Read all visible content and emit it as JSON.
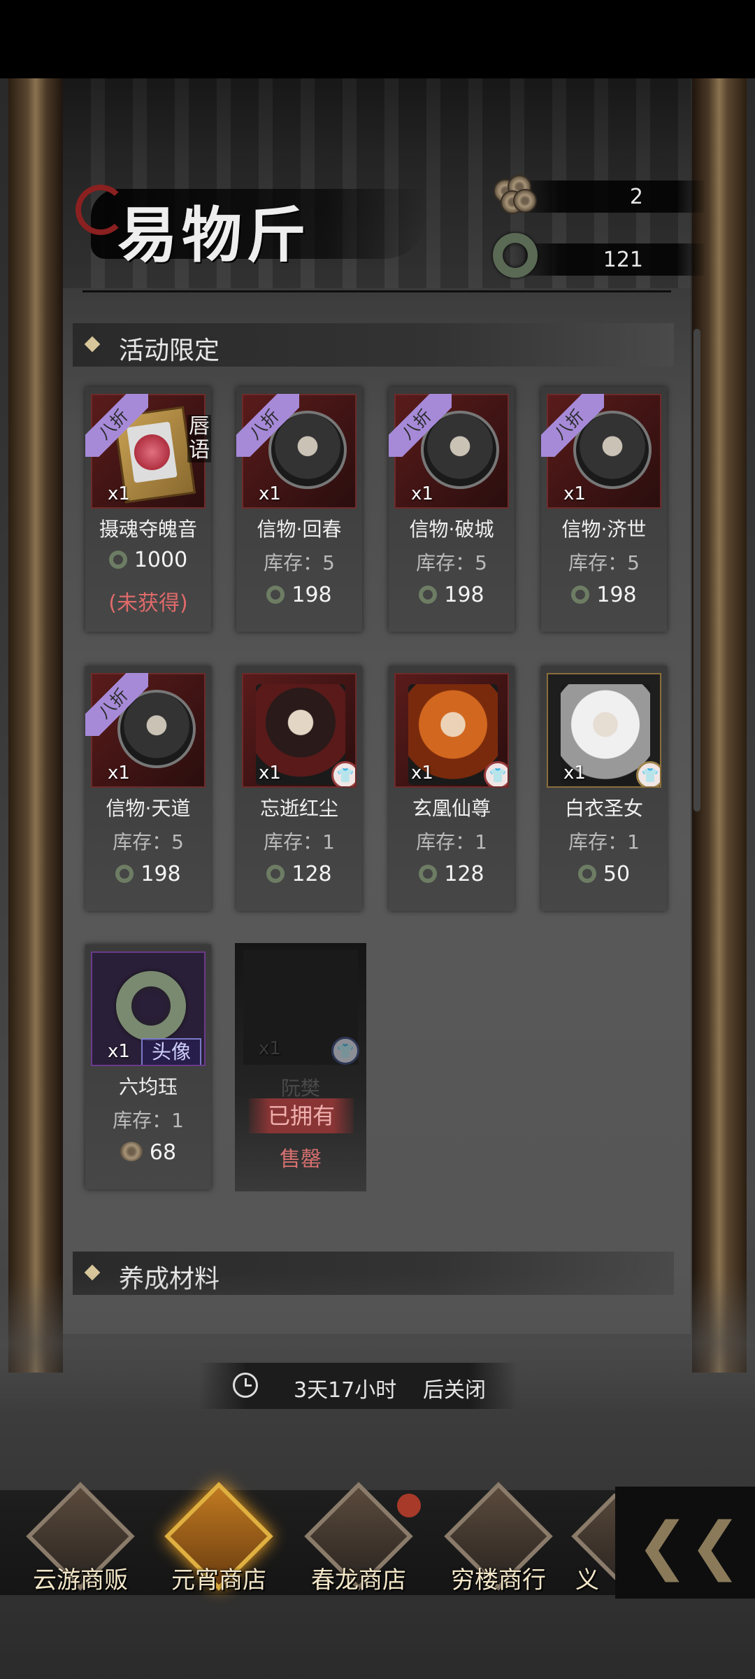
{
  "header": {
    "title": "易物斤",
    "currencies": [
      {
        "icon": "coins-icon",
        "value": "2"
      },
      {
        "icon": "jade-ring-icon",
        "value": "121"
      }
    ]
  },
  "sections": [
    {
      "label": "活动限定"
    },
    {
      "label": "养成材料"
    }
  ],
  "items": [
    {
      "name": "摄魂夺魄音",
      "qty": "x1",
      "discount": "八折",
      "side_tag": "唇语",
      "price": "1000",
      "status": "(未获得)"
    },
    {
      "name": "信物·回春",
      "qty": "x1",
      "discount": "八折",
      "stock": "库存：5",
      "price": "198"
    },
    {
      "name": "信物·破城",
      "qty": "x1",
      "discount": "八折",
      "stock": "库存：5",
      "price": "198"
    },
    {
      "name": "信物·济世",
      "qty": "x1",
      "discount": "八折",
      "stock": "库存：5",
      "price": "198"
    },
    {
      "name": "信物·天道",
      "qty": "x1",
      "discount": "八折",
      "stock": "库存：5",
      "price": "198"
    },
    {
      "name": "忘逝红尘",
      "qty": "x1",
      "stock": "库存：1",
      "price": "128"
    },
    {
      "name": "玄凰仙尊",
      "qty": "x1",
      "stock": "库存：1",
      "price": "128"
    },
    {
      "name": "白衣圣女",
      "qty": "x1",
      "stock": "库存：1",
      "price": "50"
    },
    {
      "name": "六均珏",
      "qty": "x1",
      "tag": "头像",
      "stock": "库存：1",
      "price": "68"
    },
    {
      "name": "阮樊",
      "qty": "x1",
      "owned": "已拥有",
      "sold": "售罄"
    }
  ],
  "timer": {
    "remaining": "3天17小时",
    "suffix": "后关闭"
  },
  "nav": {
    "tabs": [
      {
        "label": "云游商贩",
        "active": false
      },
      {
        "label": "元宵商店",
        "active": true
      },
      {
        "label": "春龙商店",
        "active": false,
        "badge": true
      },
      {
        "label": "穷楼商行",
        "active": false
      },
      {
        "label": "义",
        "active": false
      }
    ],
    "back_icon": "double-chevron-left-icon"
  },
  "colors": {
    "discount_ribbon": "#a68ad8",
    "unobtained": "#e06a6a",
    "accent_gold": "#d8c79a"
  }
}
